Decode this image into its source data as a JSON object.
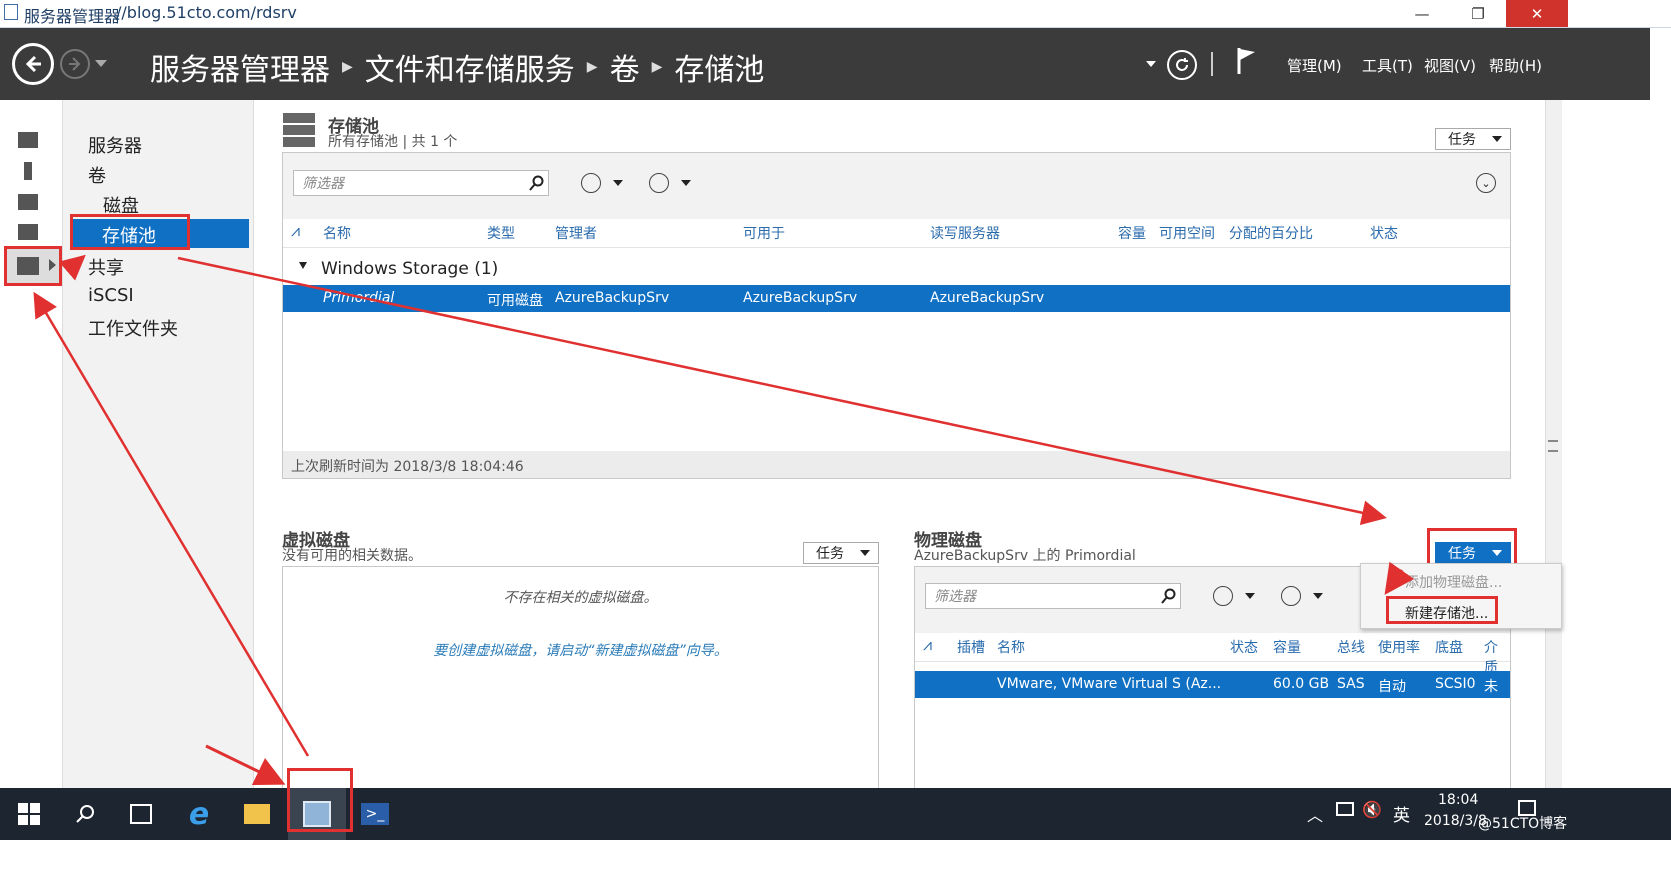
{
  "window": {
    "title": "服务器管理器",
    "url_overlay": "//blog.51cto.com/rdsrv",
    "minimize": "—",
    "restore": "❐",
    "close": "✕"
  },
  "header": {
    "breadcrumb": [
      "服务器管理器",
      "文件和存储服务",
      "卷",
      "存储池"
    ],
    "menus": [
      "管理(M)",
      "工具(T)",
      "视图(V)",
      "帮助(H)"
    ]
  },
  "nav": {
    "items": [
      {
        "label": "服务器"
      },
      {
        "label": "卷"
      },
      {
        "label": "磁盘"
      },
      {
        "label": "存储池"
      },
      {
        "label": "共享"
      },
      {
        "label": "iSCSI"
      },
      {
        "label": "工作文件夹"
      }
    ]
  },
  "storage_pools": {
    "title": "存储池",
    "subtitle": "所有存储池 | 共 1 个",
    "tasks_label": "任务",
    "filter_placeholder": "筛选器",
    "columns": [
      "名称",
      "类型",
      "管理者",
      "可用于",
      "读写服务器",
      "容量",
      "可用空间",
      "分配的百分比",
      "状态"
    ],
    "group_label": "Windows Storage (1)",
    "rows": [
      {
        "name": "Primordial",
        "type": "可用磁盘",
        "managed_by": "AzureBackupSrv",
        "available_to": "AzureBackupSrv",
        "rw_server": "AzureBackupSrv"
      }
    ],
    "last_refresh": "上次刷新时间为 2018/3/8 18:04:46"
  },
  "virtual_disks": {
    "title": "虚拟磁盘",
    "subtitle": "没有可用的相关数据。",
    "tasks_label": "任务",
    "empty_text": "不存在相关的虚拟磁盘。",
    "hint_text": "要创建虚拟磁盘，请启动“新建虚拟磁盘”向导。"
  },
  "physical_disks": {
    "title": "物理磁盘",
    "subtitle": "AzureBackupSrv 上的 Primordial",
    "tasks_label": "任务",
    "filter_placeholder": "筛选器",
    "columns": [
      "插槽",
      "名称",
      "状态",
      "容量",
      "总线",
      "使用率",
      "底盘",
      "介质"
    ],
    "rows": [
      {
        "name": "VMware, VMware Virtual S (Az...",
        "capacity": "60.0 GB",
        "bus": "SAS",
        "usage": "自动",
        "chassis": "SCSI0",
        "media": "未知"
      }
    ]
  },
  "context_menu": {
    "items": [
      "添加物理磁盘...",
      "新建存储池..."
    ]
  },
  "taskbar": {
    "time": "18:04",
    "date": "2018/3/8",
    "ime": "英",
    "watermark": "@51CTO博客"
  },
  "colors": {
    "accent": "#1070c4",
    "header_bg": "#3b3b3b",
    "annotation": "#e03030"
  }
}
